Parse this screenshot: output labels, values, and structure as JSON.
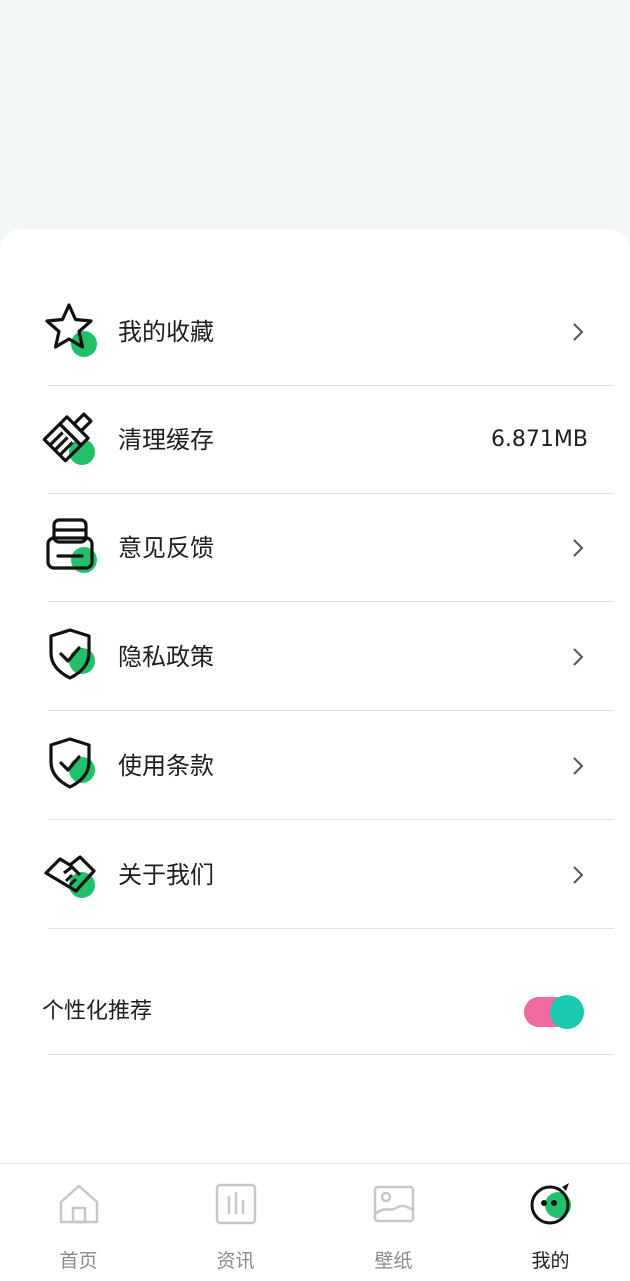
{
  "menu": {
    "items": [
      {
        "label": "我的收藏",
        "icon": "star-icon",
        "type": "link"
      },
      {
        "label": "清理缓存",
        "icon": "broom-icon",
        "type": "value",
        "value": "6.871MB"
      },
      {
        "label": "意见反馈",
        "icon": "feedback-icon",
        "type": "link"
      },
      {
        "label": "隐私政策",
        "icon": "shield-check-icon",
        "type": "link"
      },
      {
        "label": "使用条款",
        "icon": "shield-check-icon",
        "type": "link"
      },
      {
        "label": "关于我们",
        "icon": "handshake-icon",
        "type": "link"
      }
    ]
  },
  "personalized": {
    "label": "个性化推荐",
    "enabled": true
  },
  "tabbar": {
    "tabs": [
      {
        "label": "首页",
        "icon": "home-icon",
        "active": false
      },
      {
        "label": "资讯",
        "icon": "news-icon",
        "active": false
      },
      {
        "label": "壁纸",
        "icon": "wallpaper-icon",
        "active": false
      },
      {
        "label": "我的",
        "icon": "profile-face-icon",
        "active": true
      }
    ]
  },
  "colors": {
    "accent_green": "#22C06B",
    "toggle_track": "#F06BA0",
    "toggle_knob": "#1AC9B0",
    "background": "#F2F6F4"
  }
}
